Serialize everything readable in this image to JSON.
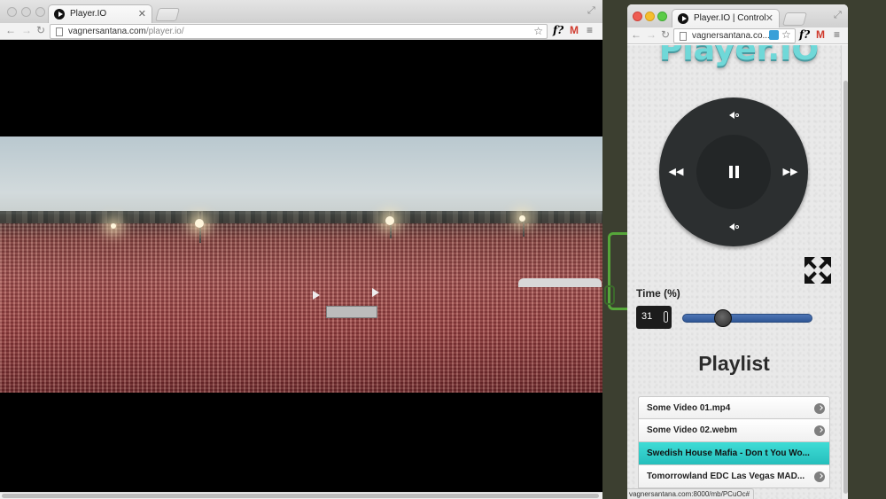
{
  "left_window": {
    "tab_title": "Player.IO",
    "url_domain": "vagnersantana.com",
    "url_path": "/player.io/"
  },
  "right_window": {
    "tab_title": "Player.IO | Control",
    "url": "vagnersantana.co...",
    "logo": "Player.IO",
    "time_label": "Time (%)",
    "time_value": "31",
    "time_percent": 31,
    "playlist_title": "Playlist",
    "playlist": [
      {
        "title": "Some Video 01.mp4",
        "active": false
      },
      {
        "title": "Some Video 02.webm",
        "active": false
      },
      {
        "title": "Swedish House Mafia - Don t You Wo...",
        "active": true
      },
      {
        "title": "Tomorrowland EDC Las Vegas MAD...",
        "active": false
      }
    ],
    "status_url": "vagnersantana.com:8000/mb/PCuOc#"
  },
  "icons": {
    "back": "back-arrow-icon",
    "forward": "forward-arrow-icon",
    "reload": "reload-icon",
    "star": "bookmark-star-icon",
    "menu": "hamburger-menu-icon",
    "pause": "pause-icon",
    "rewind": "rewind-icon",
    "fast_forward": "fast-forward-icon",
    "volume_up": "volume-up-icon",
    "volume_down": "volume-down-icon",
    "fullscreen": "fullscreen-expand-icon"
  },
  "colors": {
    "accent_teal": "#30cfc9",
    "slider_blue": "#3a62a4",
    "wheel_dark": "#2c2f30"
  }
}
